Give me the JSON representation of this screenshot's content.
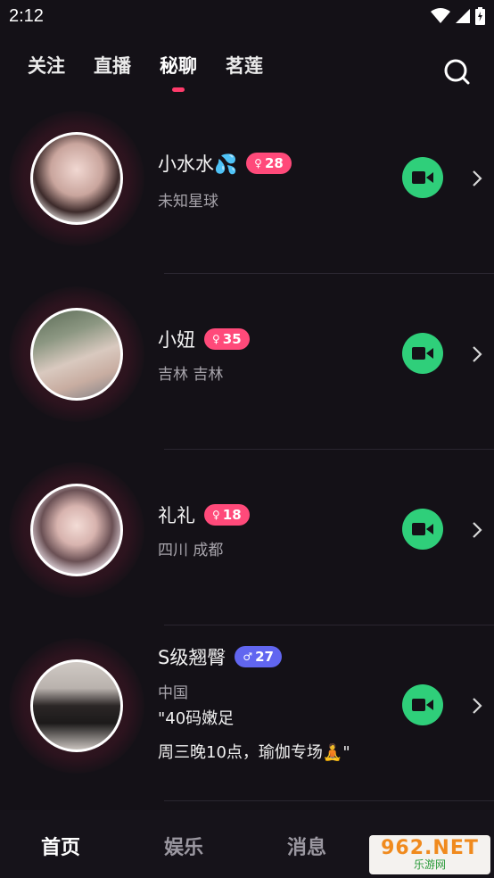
{
  "status_bar": {
    "time": "2:12"
  },
  "top_nav": {
    "tabs": [
      {
        "label": "关注",
        "active": false
      },
      {
        "label": "直播",
        "active": false
      },
      {
        "label": "秘聊",
        "active": true
      },
      {
        "label": "茗莲",
        "active": false
      }
    ],
    "search_icon": "search-icon"
  },
  "users": [
    {
      "name": "小水水",
      "emoji": "💦",
      "gender": "female",
      "gender_symbol": "♀",
      "age": "28",
      "location": "未知星球",
      "bio_lines": []
    },
    {
      "name": "小妞",
      "emoji": "",
      "gender": "female",
      "gender_symbol": "♀",
      "age": "35",
      "location": "吉林 吉林",
      "bio_lines": []
    },
    {
      "name": "礼礼",
      "emoji": "",
      "gender": "female",
      "gender_symbol": "♀",
      "age": "18",
      "location": "四川 成都",
      "bio_lines": []
    },
    {
      "name": "S级翘臀",
      "emoji": "",
      "gender": "male",
      "gender_symbol": "♂",
      "age": "27",
      "location": "中国",
      "bio_lines": [
        "\"40码嫩足",
        "周三晚10点，瑜伽专场🧘\""
      ]
    }
  ],
  "bottom_nav": {
    "items": [
      {
        "label": "首页",
        "active": true
      },
      {
        "label": "娱乐",
        "active": false
      },
      {
        "label": "消息",
        "active": false
      }
    ]
  },
  "watermark": {
    "top": "962.NET",
    "bottom": "乐游网"
  },
  "colors": {
    "background": "#141117",
    "accent": "#ff3b6b",
    "female_badge": "#ff4a7a",
    "male_badge": "#6166f0",
    "video_button": "#2fcf7a"
  }
}
